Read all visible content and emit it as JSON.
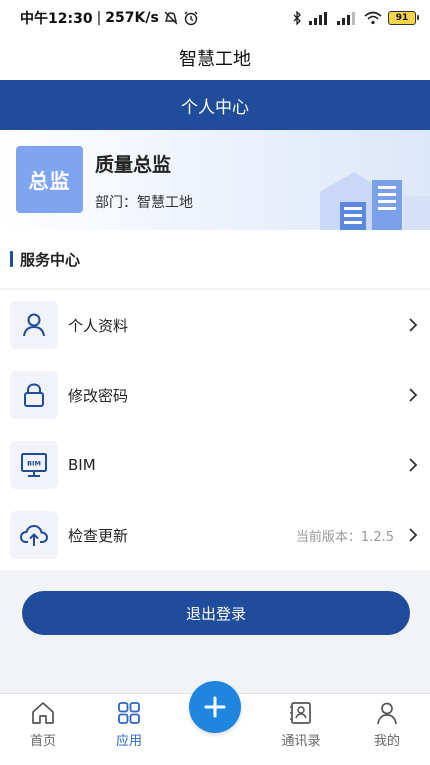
{
  "status_bar": {
    "time": "中午12:30",
    "separator": "|",
    "speed": "257K/s",
    "battery": "91"
  },
  "app": {
    "title": "智慧工地"
  },
  "header": {
    "title": "个人中心"
  },
  "profile": {
    "role_badge": "总监",
    "name": "质量总监",
    "department": "部门：智慧工地"
  },
  "section": {
    "title": "服务中心"
  },
  "menu": {
    "items": [
      {
        "label": "个人资料",
        "icon": "user-icon"
      },
      {
        "label": "修改密码",
        "icon": "lock-icon"
      },
      {
        "label": "BIM",
        "icon": "bim-monitor-icon",
        "icon_text": "BIM"
      },
      {
        "label": "检查更新",
        "icon": "cloud-upload-icon",
        "extra": "当前版本：1.2.5"
      }
    ]
  },
  "logout": {
    "label": "退出登录"
  },
  "tabs": [
    {
      "label": "首页",
      "icon": "home-icon",
      "active": false
    },
    {
      "label": "应用",
      "icon": "apps-grid-icon",
      "active": true
    },
    {
      "label": "",
      "icon": "plus-icon",
      "active": false
    },
    {
      "label": "通讯录",
      "icon": "contacts-icon",
      "active": false
    },
    {
      "label": "我的",
      "icon": "person-icon",
      "active": false
    }
  ],
  "colors": {
    "primary": "#1f4c9b",
    "active_tab": "#2d66c3",
    "fab": "#1f86e0",
    "avatar": "#7fa5f0"
  }
}
